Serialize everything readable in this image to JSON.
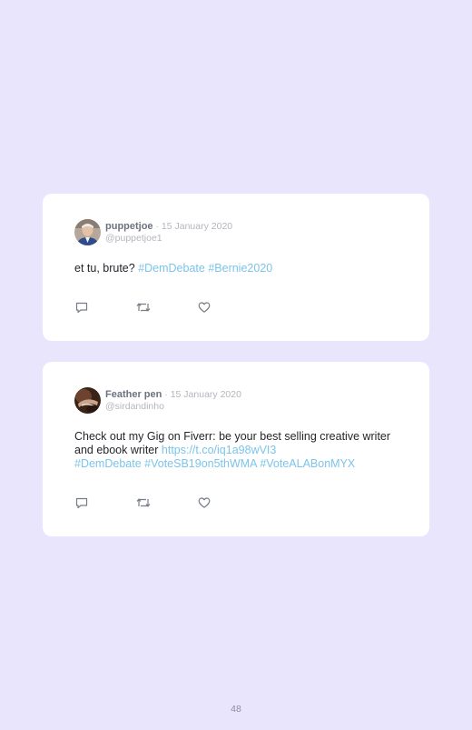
{
  "tweets": [
    {
      "name": "puppetjoe",
      "separator": " · ",
      "date": "15 January 2020",
      "handle": "@puppetjoe1",
      "text_plain": "et tu, brute? ",
      "hashtag_1": "#DemDebate",
      "hashtag_2": "#Bernie2020",
      "actions": [
        "reply-icon",
        "retweet-icon",
        "like-icon"
      ]
    },
    {
      "name": "Feather pen",
      "separator": " · ",
      "date": "15 January 2020",
      "handle": "@sirdandinho",
      "text_plain": "Check out my Gig on Fiverr: be your best selling creative writer and ebook writer ",
      "url": "https://t.co/iq1a98wVI3",
      "hashtag_1": "#DemDebate",
      "hashtag_2": "#VoteSB19on5thWMA",
      "hashtag_3": "#VoteALABonMYX",
      "actions": [
        "reply-icon",
        "retweet-icon",
        "like-icon"
      ]
    }
  ],
  "page_number": "48",
  "colors": {
    "background": "#e9e5fd",
    "card": "#ffffff",
    "link": "#7cc4ea",
    "name": "#6c7380",
    "meta": "#b3b6bd",
    "text": "#23262b"
  }
}
